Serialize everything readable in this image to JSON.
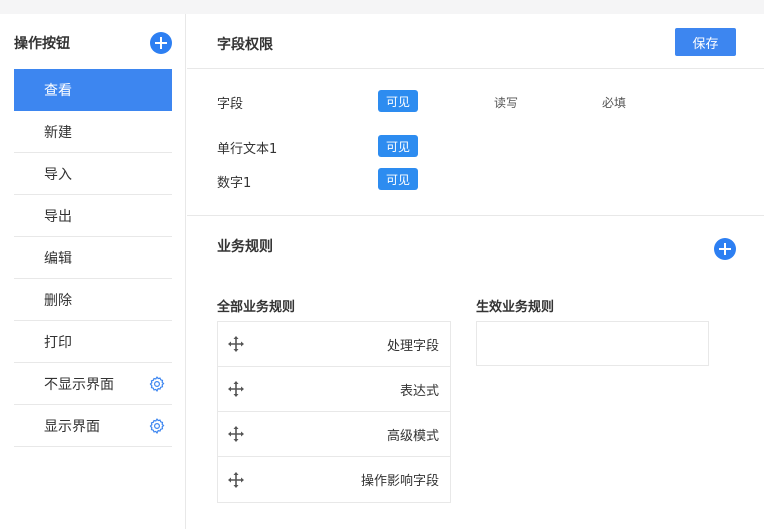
{
  "sidebar": {
    "title": "操作按钮",
    "add_icon": "plus-circle-icon",
    "items": [
      {
        "label": "查看",
        "active": true,
        "has_gear": false
      },
      {
        "label": "新建",
        "active": false,
        "has_gear": false
      },
      {
        "label": "导入",
        "active": false,
        "has_gear": false
      },
      {
        "label": "导出",
        "active": false,
        "has_gear": false
      },
      {
        "label": "编辑",
        "active": false,
        "has_gear": false
      },
      {
        "label": "删除",
        "active": false,
        "has_gear": false
      },
      {
        "label": "打印",
        "active": false,
        "has_gear": false
      },
      {
        "label": "不显示界面",
        "active": false,
        "has_gear": true
      },
      {
        "label": "显示界面",
        "active": false,
        "has_gear": true
      }
    ],
    "accent": "#3d86f0"
  },
  "field_permissions": {
    "title": "字段权限",
    "save_label": "保存",
    "header": {
      "label": "字段",
      "visible": "可见",
      "read_write": "读写",
      "required": "必填"
    },
    "rows": [
      {
        "field": "单行文本1",
        "permission": "可见"
      },
      {
        "field": "数字1",
        "permission": "可见"
      }
    ]
  },
  "business_rules": {
    "title": "业务规则",
    "add_icon": "plus-circle-icon",
    "all_rules_label": "全部业务规则",
    "active_rules_label": "生效业务规则",
    "all_rules": [
      "处理字段",
      "表达式",
      "高级模式",
      "操作影响字段"
    ],
    "active_rules": []
  }
}
